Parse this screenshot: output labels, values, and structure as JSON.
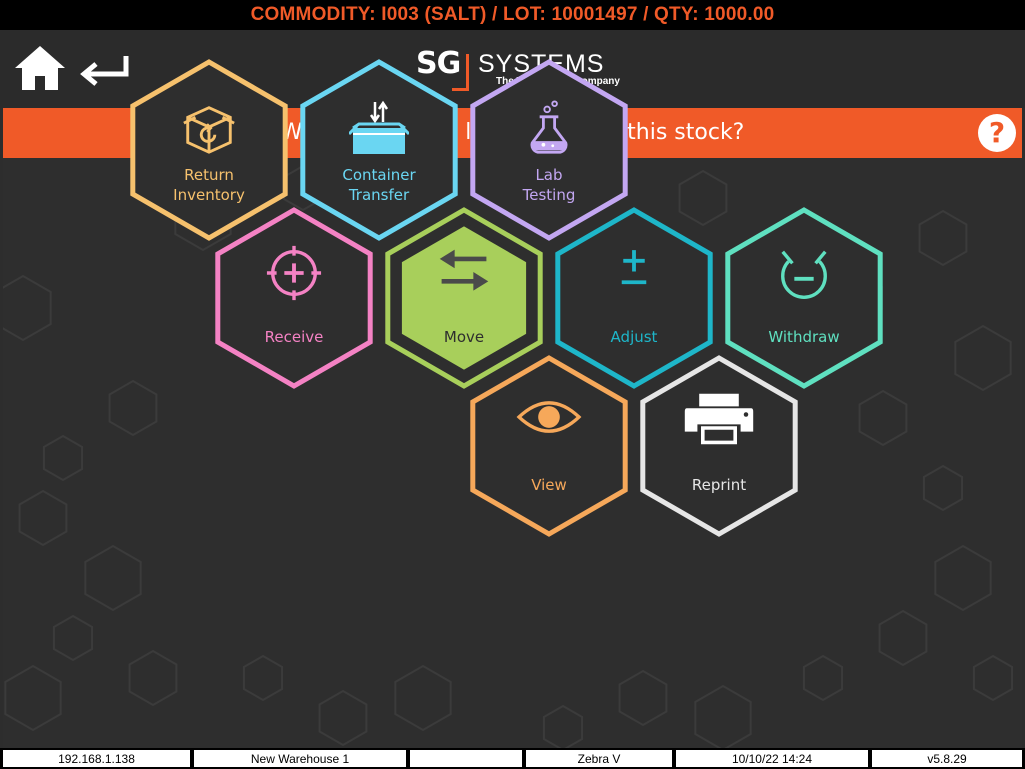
{
  "topbar": {
    "info": "COMMODITY: I003 (SALT) / LOT: 10001497 / QTY: 1000.00"
  },
  "header": {
    "logo_mark": "SG",
    "logo_word": "SYSTEMS",
    "logo_tagline": "The Traceability Company"
  },
  "prompt": {
    "text": "What would you like to do with this stock?",
    "help": "?"
  },
  "actions": [
    {
      "id": "return-inventory",
      "line1": "Return",
      "line2": "Inventory",
      "color": "#f6c16d",
      "icon": "return-box-icon"
    },
    {
      "id": "container-transfer",
      "line1": "Container",
      "line2": "Transfer",
      "color": "#6ad6f2",
      "icon": "container-transfer-icon"
    },
    {
      "id": "lab-testing",
      "line1": "Lab",
      "line2": "Testing",
      "color": "#c3a7f2",
      "icon": "flask-icon"
    },
    {
      "id": "receive",
      "line1": "Receive",
      "color": "#f482c4",
      "icon": "crosshair-plus-icon"
    },
    {
      "id": "move",
      "line1": "Move",
      "color": "#a8cf5b",
      "icon": "swap-arrows-icon",
      "selected": true
    },
    {
      "id": "adjust",
      "line1": "Adjust",
      "color": "#1eb6c9",
      "icon": "plus-minus-icon"
    },
    {
      "id": "withdraw",
      "line1": "Withdraw",
      "color": "#5fe0c0",
      "icon": "withdraw-icon"
    },
    {
      "id": "view",
      "line1": "View",
      "color": "#f6a85a",
      "icon": "eye-icon"
    },
    {
      "id": "reprint",
      "line1": "Reprint",
      "color": "#e6e6e6",
      "icon": "printer-icon"
    }
  ],
  "status": {
    "ip": "192.168.1.138",
    "warehouse": "New Warehouse 1",
    "blank": "",
    "printer": "Zebra V",
    "datetime": "10/10/22 14:24",
    "version": "v5.8.29"
  },
  "colors": {
    "accent": "#f05a28",
    "background": "#2e2e2e",
    "move_text": "#2e2e2e"
  }
}
